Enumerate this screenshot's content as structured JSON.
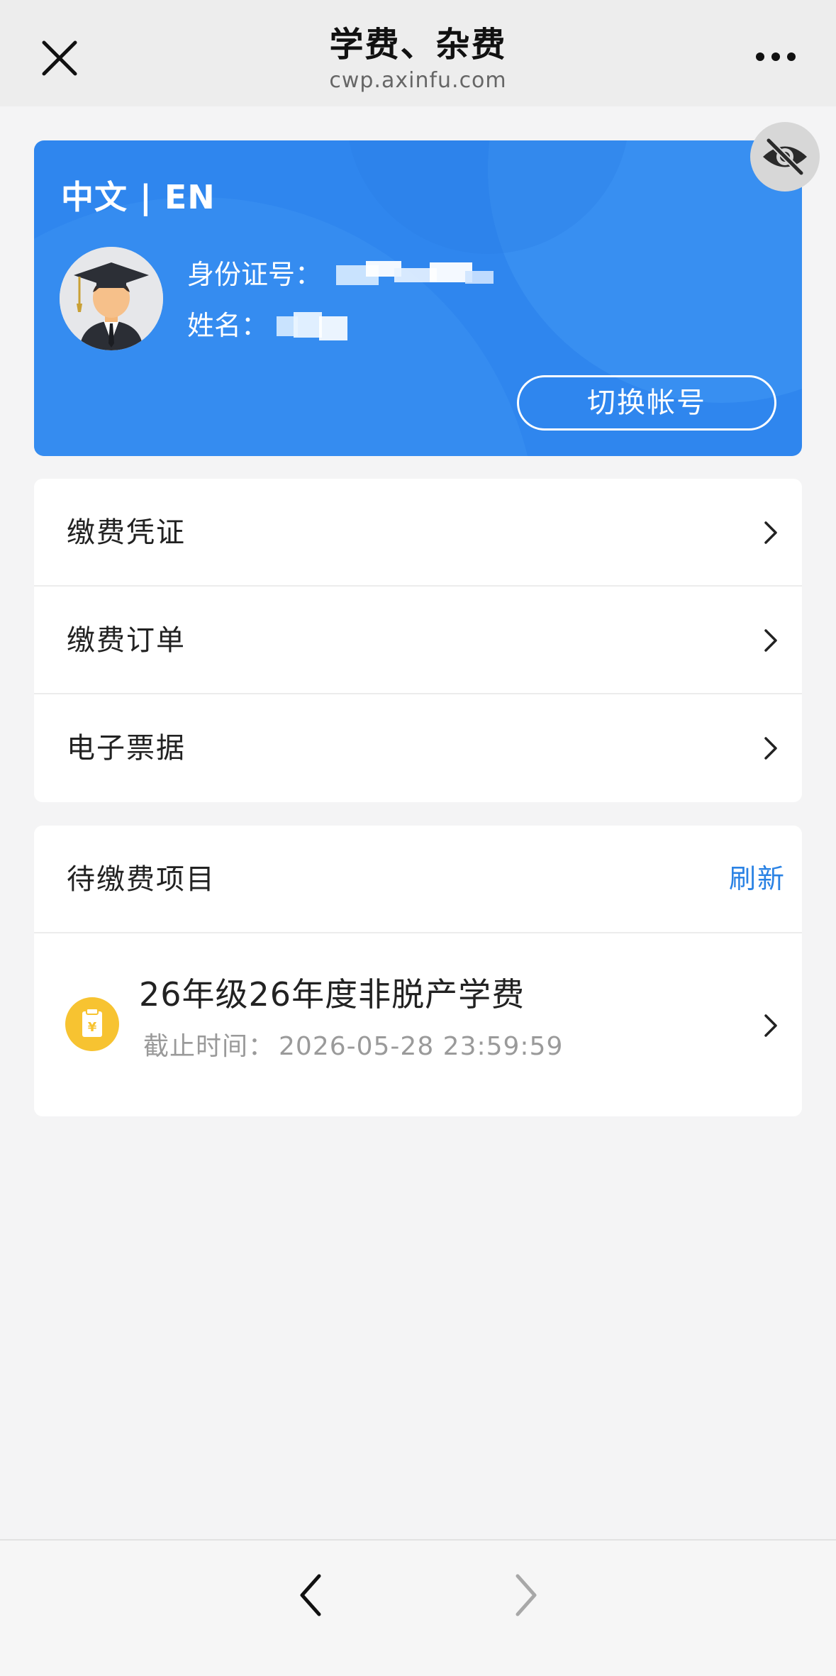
{
  "header": {
    "title": "学费、杂费",
    "subtitle": "cwp.axinfu.com",
    "close_icon": "close-icon",
    "more_icon": "more-dots-icon"
  },
  "profile": {
    "lang_toggle": "中文 | EN",
    "id_label": "身份证号：",
    "name_label": "姓名：",
    "switch_account": "切换帐号",
    "avatar_icon": "graduate-avatar-icon",
    "eye_icon": "eye-off-icon",
    "accent_color": "#2f86ee"
  },
  "menu": {
    "items": [
      {
        "label": "缴费凭证"
      },
      {
        "label": "缴费订单"
      },
      {
        "label": "电子票据"
      }
    ]
  },
  "pending": {
    "title": "待缴费项目",
    "refresh": "刷新",
    "items": [
      {
        "name": "26年级26年度非脱产学费",
        "deadline_label": "截止时间：",
        "deadline_value": "2026-05-28 23:59:59",
        "icon": "fee-clipboard-yen-icon"
      }
    ]
  },
  "bottom_nav": {
    "back_icon": "chevron-left-icon",
    "forward_icon": "chevron-right-icon"
  },
  "colors": {
    "link_blue": "#2a82e4",
    "icon_yellow": "#f7c331"
  }
}
